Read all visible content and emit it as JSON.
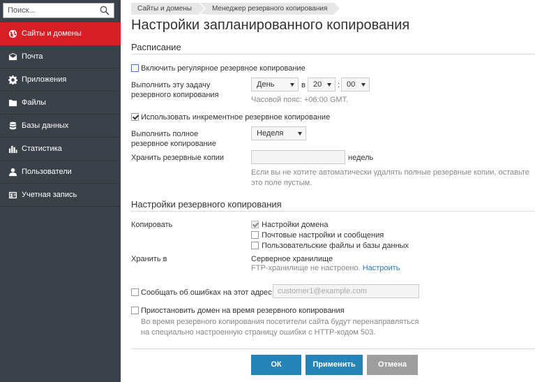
{
  "search": {
    "placeholder": "Поиск..."
  },
  "nav": [
    {
      "label": "Сайты и домены",
      "icon": "globe-icon",
      "active": true
    },
    {
      "label": "Почта",
      "icon": "mail-icon"
    },
    {
      "label": "Приложения",
      "icon": "gear-icon"
    },
    {
      "label": "Файлы",
      "icon": "folder-icon"
    },
    {
      "label": "Базы данных",
      "icon": "database-icon"
    },
    {
      "label": "Статистика",
      "icon": "chart-icon"
    },
    {
      "label": "Пользователи",
      "icon": "user-icon"
    },
    {
      "label": "Учетная запись",
      "icon": "account-icon"
    }
  ],
  "breadcrumb": [
    "Сайты и домены",
    "Менеджер резервного копирования"
  ],
  "page_title": "Настройки запланированного копирования",
  "schedule": {
    "section_title": "Расписание",
    "enable_label": "Включить регулярное резервное копирование",
    "run_label_1": "Выполнить эту задачу",
    "run_label_2": "резервного копирования",
    "period_value": "День",
    "at_label": "в",
    "hour_value": "20",
    "colon": ":",
    "minute_value": "00",
    "timezone": "Часовой пояс: +06:00 GMT.",
    "incremental_label": "Использовать инкрементное резервное копирование",
    "full_label_1": "Выполнить полное",
    "full_label_2": "резервное копирование",
    "full_value": "Неделя",
    "keep_label": "Хранить резервные копии",
    "keep_value": "",
    "keep_unit": "недель",
    "keep_hint_1": "Если вы не хотите автоматически удалять полные резервные копии, оставьте",
    "keep_hint_2": "это поле пустым."
  },
  "backup": {
    "section_title": "Настройки резервного копирования",
    "copy_label": "Копировать",
    "options": [
      {
        "label": "Настройки домена",
        "checked": true,
        "disabled": true
      },
      {
        "label": "Почтовые настройки и сообщения",
        "checked": false
      },
      {
        "label": "Пользовательские файлы и базы данных",
        "checked": false
      }
    ],
    "store_label": "Хранить в",
    "store_value": "Серверное хранилище",
    "ftp_text": "FTP-хранилище не настроено.",
    "ftp_link": "Настроить",
    "notify_label": "Сообщать об ошибках на этот адрес",
    "notify_placeholder": "customer1@example.com",
    "suspend_label": "Приостановить домен на время резервного копирования",
    "suspend_hint_1": "Во время резервного копирования посетители сайта будут перенаправляться",
    "suspend_hint_2": "на специально настроенную страницу ошибки с HTTP-кодом 503."
  },
  "buttons": {
    "ok": "ОК",
    "apply": "Применить",
    "cancel": "Отмена"
  },
  "colors": {
    "sidebar": "#3a4148",
    "active": "#d71f26",
    "primary": "#2784b9",
    "cancel": "#9e9e9e",
    "link": "#2a7abf"
  }
}
